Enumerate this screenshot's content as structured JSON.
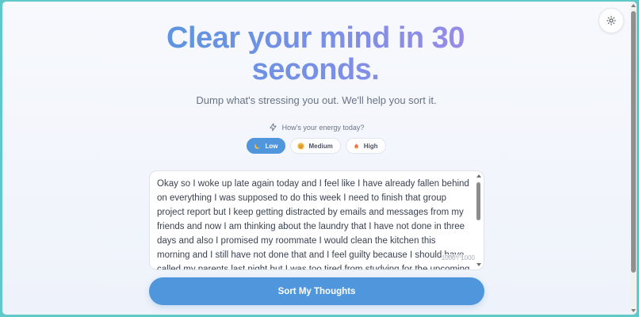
{
  "header": {
    "title": "Clear your mind in 30 seconds.",
    "subtitle": "Dump what's stressing you out. We'll help you sort it."
  },
  "energy": {
    "question": "How's your energy today?",
    "options": [
      {
        "label": "Low",
        "icon": "crescent-moon-icon",
        "selected": true
      },
      {
        "label": "Medium",
        "icon": "smile-face-icon",
        "selected": false
      },
      {
        "label": "High",
        "icon": "flame-icon",
        "selected": false
      }
    ]
  },
  "input": {
    "value": "Okay so I woke up late again today and I feel like I have already fallen behind on everything I was supposed to do this week I need to finish that group project report but I keep getting distracted by emails and messages from my friends and now I am thinking about the laundry that I have not done in three days and also I promised my roommate I would clean the kitchen this morning and I still have not done that and I feel guilty because I should have called my parents last night but I was too tired from studying for the upcoming exam I",
    "char_count": "1000 / 1000"
  },
  "actions": {
    "submit_label": "Sort My Thoughts"
  },
  "colors": {
    "accent": "#4f96dd",
    "title_gradient_start": "#5a95e0",
    "title_gradient_end": "#9b8be6",
    "page_background": "#f4f6fb"
  }
}
